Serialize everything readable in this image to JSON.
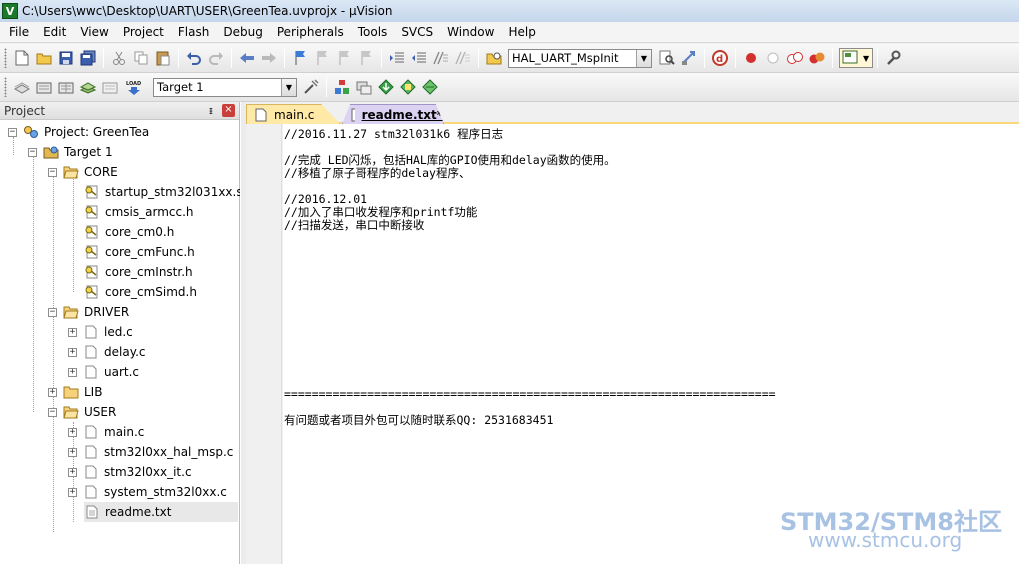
{
  "window": {
    "title": "C:\\Users\\wwc\\Desktop\\UART\\USER\\GreenTea.uvprojx - µVision",
    "app_icon_letter": "V"
  },
  "menu": [
    "File",
    "Edit",
    "View",
    "Project",
    "Flash",
    "Debug",
    "Peripherals",
    "Tools",
    "SVCS",
    "Window",
    "Help"
  ],
  "toolbar": {
    "function_combo_value": "HAL_UART_MspInit",
    "target_combo_value": "Target 1",
    "load_label": "LOAD"
  },
  "project_panel": {
    "title": "Project",
    "pin": "ᵻ",
    "close": "×",
    "tree": {
      "project": "Project: GreenTea",
      "target": "Target 1",
      "groups": {
        "core": {
          "name": "CORE",
          "files": [
            "startup_stm32l031xx.s",
            "cmsis_armcc.h",
            "core_cm0.h",
            "core_cmFunc.h",
            "core_cmInstr.h",
            "core_cmSimd.h"
          ]
        },
        "driver": {
          "name": "DRIVER",
          "files": [
            "led.c",
            "delay.c",
            "uart.c"
          ]
        },
        "lib": {
          "name": "LIB"
        },
        "user": {
          "name": "USER",
          "files": [
            "main.c",
            "stm32l0xx_hal_msp.c",
            "stm32l0xx_it.c",
            "system_stm32l0xx.c",
            "readme.txt"
          ]
        }
      },
      "expander_plus": "+",
      "expander_minus": "−"
    }
  },
  "editor": {
    "tabs": [
      {
        "label": "main.c"
      },
      {
        "label": "readme.txt*"
      }
    ],
    "lines": [
      "//2016.11.27 stm32l031k6 程序日志",
      "",
      "//完成 LED闪烁，包括HAL库的GPIO使用和delay函数的使用。",
      "//移植了原子哥程序的delay程序、",
      "",
      "//2016.12.01",
      "//加入了串口收发程序和printf功能",
      "//扫描发送，串口中断接收",
      "",
      "",
      "",
      "",
      "",
      "",
      "",
      "",
      "",
      "",
      "",
      "",
      "=======================================================================",
      "",
      "有问题或者项目外包可以随时联系QQ: 2531683451"
    ]
  },
  "watermark": {
    "line1": "STM32/STM8社区",
    "line2": "www.stmcu.org"
  },
  "colors": {
    "tab_active_bg": "#dcd3f2",
    "tab_inactive_bg": "#ffe9a6",
    "watermark": "#a8c2e4"
  }
}
